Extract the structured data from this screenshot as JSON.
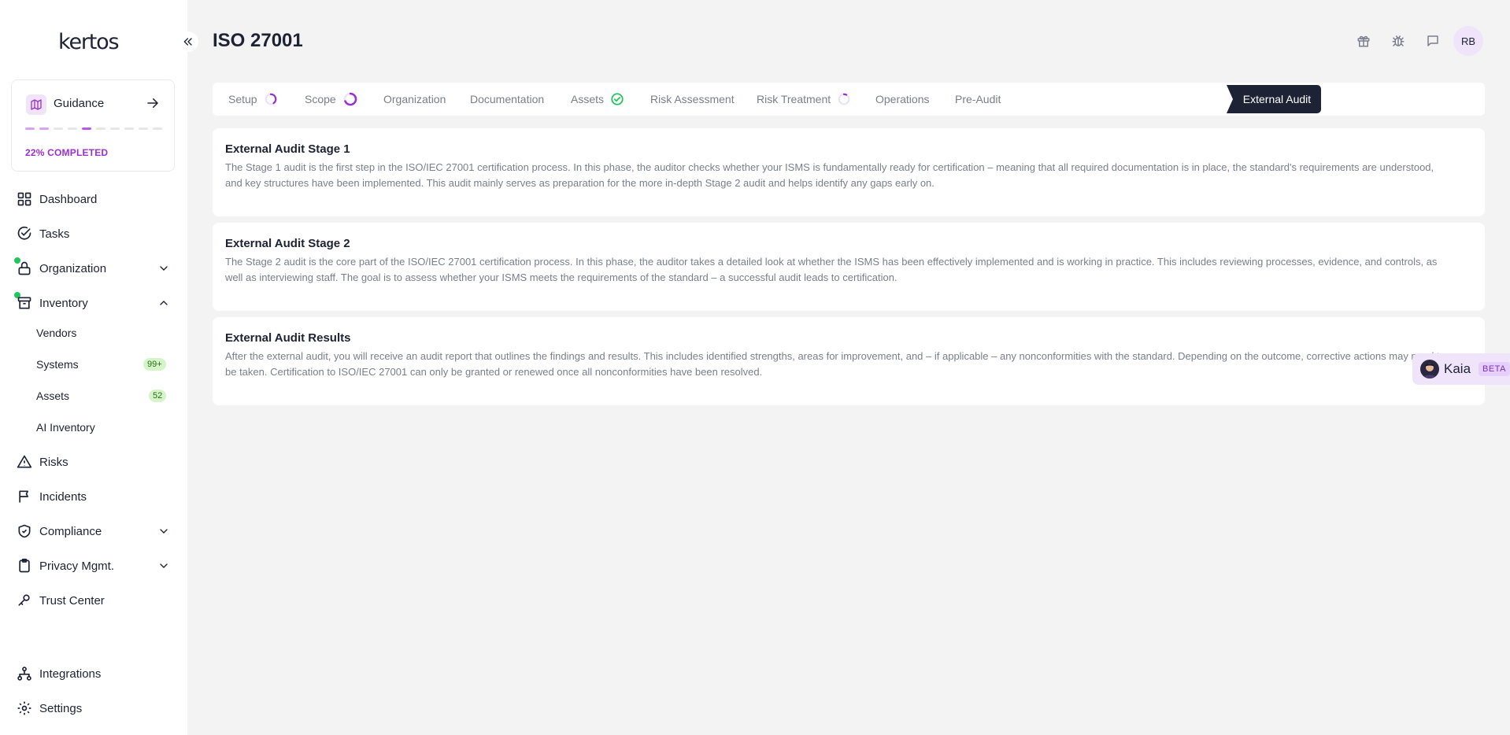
{
  "app": {
    "logo": "kertos",
    "collapse_label": "«"
  },
  "guidance": {
    "title": "Guidance",
    "progress": 0.22,
    "progress_label": "22% COMPLETED"
  },
  "sidebar": {
    "items": [
      {
        "label": "Dashboard",
        "icon": "dashboard-icon"
      },
      {
        "label": "Tasks",
        "icon": "check-circle-icon"
      },
      {
        "label": "Organization",
        "icon": "lock-icon",
        "expanded": false,
        "status_dot": "#22c55e"
      },
      {
        "label": "Inventory",
        "icon": "archive-icon",
        "expanded": true,
        "status_dot": "#22c55e"
      },
      {
        "label": "Risks",
        "icon": "warning-icon"
      },
      {
        "label": "Incidents",
        "icon": "flag-icon"
      },
      {
        "label": "Compliance",
        "icon": "shield-check-icon",
        "expanded": false
      },
      {
        "label": "Privacy Mgmt.",
        "icon": "clipboard-icon",
        "expanded": false
      },
      {
        "label": "Trust Center",
        "icon": "key-icon"
      },
      {
        "label": "Integrations",
        "icon": "network-icon"
      },
      {
        "label": "Settings",
        "icon": "gear-icon"
      }
    ],
    "inventory_sub": [
      {
        "label": "Vendors"
      },
      {
        "label": "Systems",
        "badge": "99+"
      },
      {
        "label": "Assets",
        "badge": "52"
      },
      {
        "label": "AI Inventory"
      }
    ]
  },
  "header": {
    "title": "ISO 27001",
    "icons": [
      "gift-icon",
      "bug-icon",
      "chat-icon"
    ],
    "avatar_initials": "RB"
  },
  "tabs": [
    {
      "label": "Setup",
      "status": "in-progress"
    },
    {
      "label": "Scope",
      "status": "in-progress"
    },
    {
      "label": "Organization",
      "status": "none"
    },
    {
      "label": "Documentation",
      "status": "none"
    },
    {
      "label": "Assets",
      "status": "complete"
    },
    {
      "label": "Risk Assessment",
      "status": "none"
    },
    {
      "label": "Risk Treatment",
      "status": "started"
    },
    {
      "label": "Operations",
      "status": "none"
    },
    {
      "label": "Pre-Audit",
      "status": "none"
    },
    {
      "label": "External Audit",
      "status": "active"
    }
  ],
  "cards": [
    {
      "title": "External Audit Stage 1",
      "body": "The Stage 1 audit is the first step in the ISO/IEC 27001 certification process. In this phase, the auditor checks whether your ISMS is fundamentally ready for certification – meaning that all required documentation is in place, the standard's requirements are understood, and key structures have been implemented. This audit mainly serves as preparation for the more in-depth Stage 2 audit and helps identify any gaps early on."
    },
    {
      "title": "External Audit Stage 2",
      "body": "The Stage 2 audit is the core part of the ISO/IEC 27001 certification process. In this phase, the auditor takes a detailed look at whether the ISMS has been effectively implemented and is working in practice. This includes reviewing processes, evidence, and controls, as well as interviewing staff. The goal is to assess whether your ISMS meets the requirements of the standard – a successful audit leads to certification."
    },
    {
      "title": "External Audit Results",
      "body": "After the external audit, you will receive an audit report that outlines the findings and results. This includes identified strengths, areas for improvement, and – if applicable – any nonconformities with the standard. Depending on the outcome, corrective actions may need to be taken. Certification to ISO/IEC 27001 can only be granted or renewed once all nonconformities have been resolved."
    }
  ],
  "assistant": {
    "name": "Kaia",
    "badge": "BETA"
  },
  "colors": {
    "accent": "#9b2fd6",
    "navy": "#1e2235",
    "success": "#22c55e",
    "muted_text": "#7a7f8c"
  }
}
